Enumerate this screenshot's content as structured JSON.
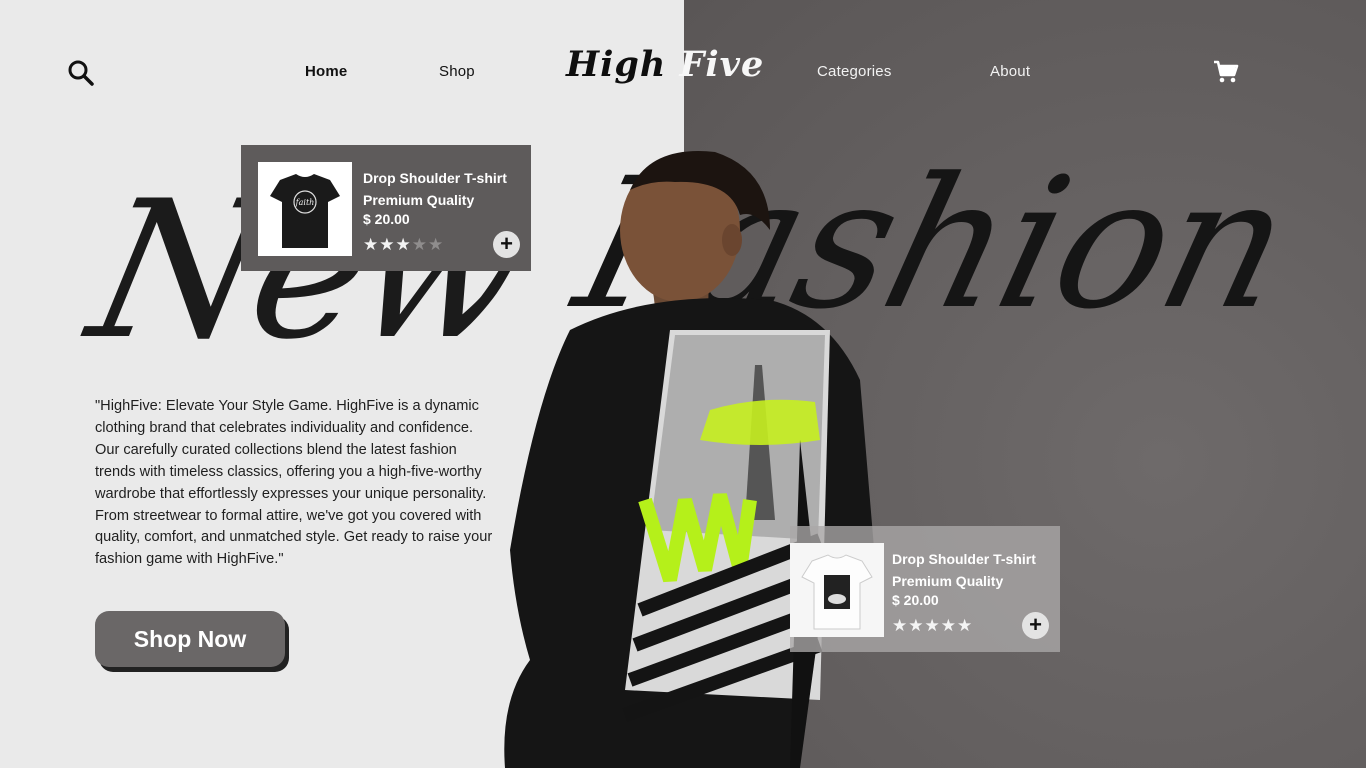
{
  "nav": {
    "links": [
      "Home",
      "Shop",
      "Categories",
      "About"
    ],
    "logo_left": "High",
    "logo_right": "Five",
    "search_icon": "search-icon",
    "cart_icon": "cart-icon"
  },
  "hero": {
    "headline_word_1": "New",
    "headline_word_2": "Fashion",
    "description": "\"HighFive: Elevate Your Style Game. HighFive is a dynamic clothing brand that celebrates individuality and confidence. Our carefully curated collections blend the latest fashion trends with timeless classics, offering you a high-five-worthy wardrobe that effortlessly expresses your unique personality. From streetwear to formal attire, we've got you covered with quality, comfort, and unmatched style. Get ready to raise your fashion game with HighFive.\"",
    "cta_label": "Shop Now"
  },
  "products": [
    {
      "name": "Drop Shoulder T-shirt Premium Quality",
      "price": "$ 20.00",
      "rating": 3,
      "max_rating": 5,
      "add_label": "+"
    },
    {
      "name": "Drop Shoulder T-shirt Premium Quality",
      "price": "$ 20.00",
      "rating": 5,
      "max_rating": 5,
      "add_label": "+"
    }
  ],
  "colors": {
    "left_bg": "#eaeaea",
    "right_bg": "#635f5f",
    "button": "#6a6767",
    "text_dark": "#1f1f1f"
  }
}
